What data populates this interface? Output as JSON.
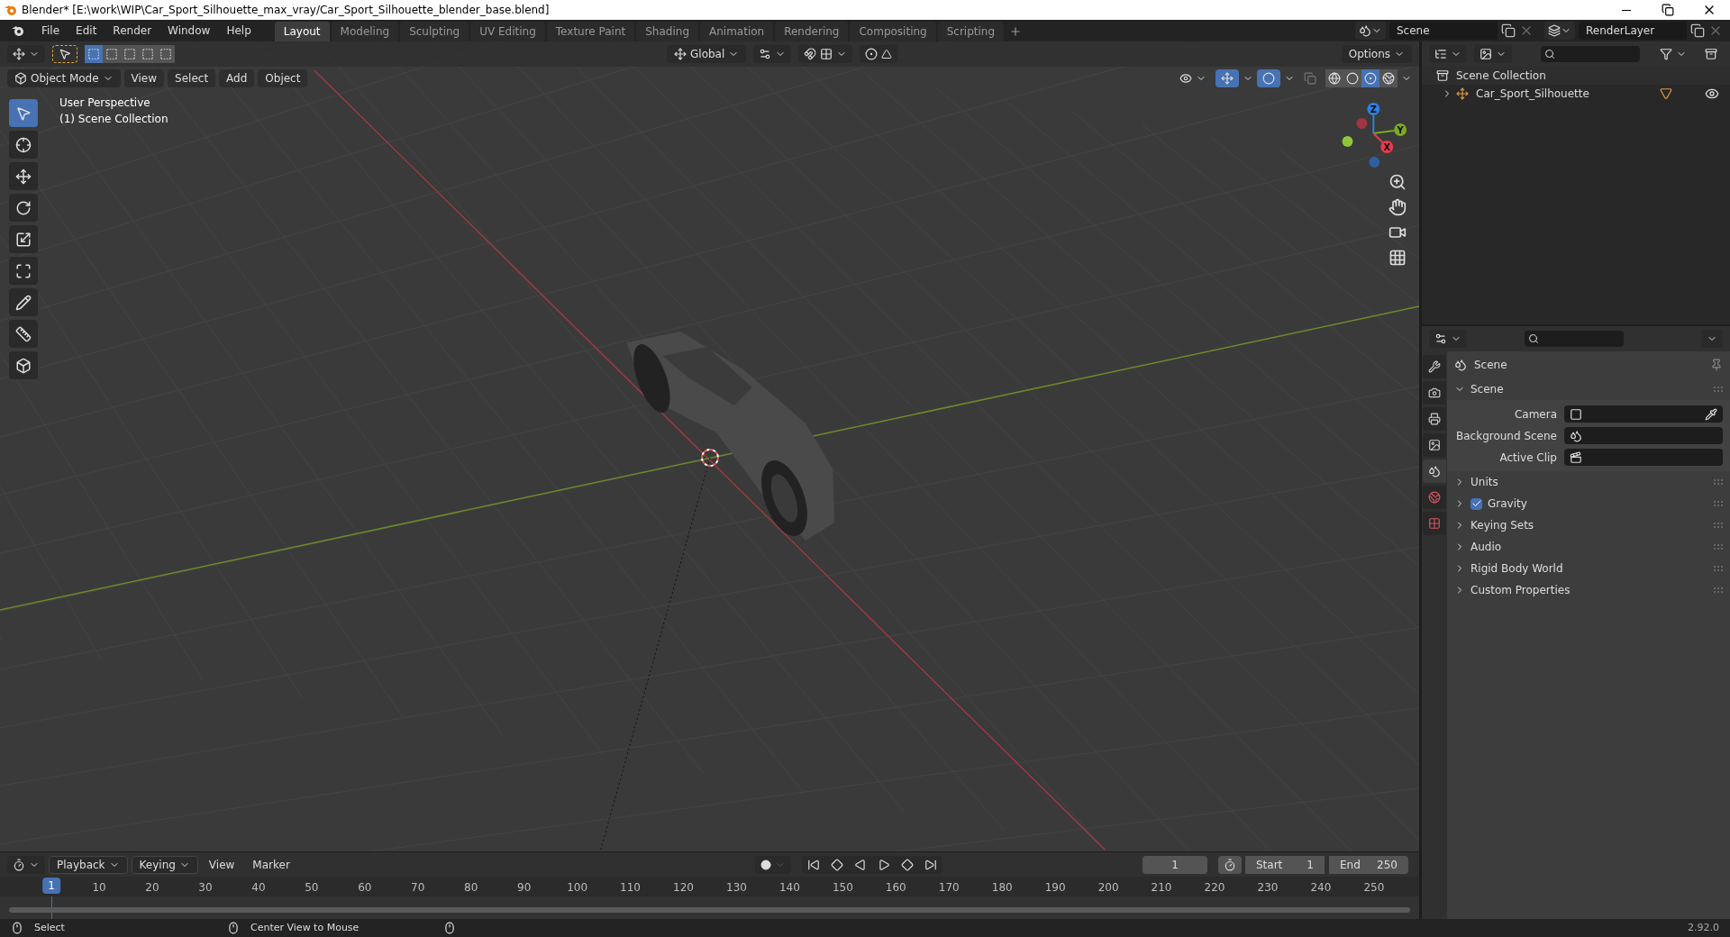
{
  "window": {
    "title": "Blender* [E:\\work\\WIP\\Car_Sport_Silhouette_max_vray/Car_Sport_Silhouette_blender_base.blend]"
  },
  "menu": [
    "File",
    "Edit",
    "Render",
    "Window",
    "Help"
  ],
  "workspaces": [
    {
      "label": "Layout",
      "selected": true
    },
    {
      "label": "Modeling",
      "selected": false
    },
    {
      "label": "Sculpting",
      "selected": false
    },
    {
      "label": "UV Editing",
      "selected": false
    },
    {
      "label": "Texture Paint",
      "selected": false
    },
    {
      "label": "Shading",
      "selected": false
    },
    {
      "label": "Animation",
      "selected": false
    },
    {
      "label": "Rendering",
      "selected": false
    },
    {
      "label": "Compositing",
      "selected": false
    },
    {
      "label": "Scripting",
      "selected": false
    }
  ],
  "scene": "Scene",
  "view_layer": "RenderLayer",
  "tool_header": {
    "transform_orientation": "Global",
    "options": "Options",
    "select_modes": [
      {
        "selected": true
      },
      {
        "selected": false
      },
      {
        "selected": false
      },
      {
        "selected": false
      },
      {
        "selected": false
      }
    ]
  },
  "viewport_header": {
    "mode": "Object Mode",
    "menus": [
      "View",
      "Select",
      "Add",
      "Object"
    ],
    "gizmos_on": true,
    "overlays_on": true,
    "shading": [
      {
        "kind": "wireframe",
        "selected": false
      },
      {
        "kind": "solid",
        "selected": false
      },
      {
        "kind": "material",
        "selected": true
      },
      {
        "kind": "rendered",
        "selected": false
      }
    ]
  },
  "viewport": {
    "overlay_text": [
      "User Perspective",
      "(1) Scene Collection"
    ],
    "tools": [
      {
        "kind": "select",
        "selected": true
      },
      {
        "kind": "cursor",
        "selected": false
      },
      {
        "kind": "move",
        "selected": false
      },
      {
        "kind": "rotate",
        "selected": false
      },
      {
        "kind": "scale",
        "selected": false
      },
      {
        "kind": "transform",
        "selected": false
      },
      {
        "kind": "annotate",
        "selected": false
      },
      {
        "kind": "measure",
        "selected": false
      },
      {
        "kind": "add_cube",
        "selected": false
      }
    ],
    "gizmo_axes": [
      {
        "label": "Z",
        "color": "#2f7fe0"
      },
      {
        "label": "Y",
        "color": "#7aaa1e"
      },
      {
        "label": "X",
        "color": "#e83a4e"
      }
    ]
  },
  "outliner": {
    "root": "Scene Collection",
    "children": [
      {
        "label": "Car_Sport_Silhouette",
        "expanded": false,
        "visible": true
      }
    ]
  },
  "properties": {
    "tabs": [
      {
        "kind": "tool",
        "selected": false
      },
      {
        "kind": "render",
        "selected": false
      },
      {
        "kind": "output",
        "selected": false
      },
      {
        "kind": "view_layer",
        "selected": false
      },
      {
        "kind": "scene",
        "selected": true
      },
      {
        "kind": "world",
        "selected": false
      },
      {
        "kind": "texture",
        "selected": false
      }
    ],
    "context": "Scene",
    "panels": [
      {
        "label": "Scene",
        "expanded": true,
        "fields": [
          {
            "label": "Camera",
            "kind": "object"
          },
          {
            "label": "Background Scene",
            "kind": "scene"
          },
          {
            "label": "Active Clip",
            "kind": "clip"
          }
        ]
      },
      {
        "label": "Units",
        "expanded": false
      },
      {
        "label": "Gravity",
        "expanded": false,
        "checked": true
      },
      {
        "label": "Keying Sets",
        "expanded": false
      },
      {
        "label": "Audio",
        "expanded": false
      },
      {
        "label": "Rigid Body World",
        "expanded": false
      },
      {
        "label": "Custom Properties",
        "expanded": false
      }
    ]
  },
  "timeline": {
    "menus": [
      {
        "label": "Playback",
        "dropdown": true
      },
      {
        "label": "Keying",
        "dropdown": true
      },
      {
        "label": "View",
        "dropdown": false
      },
      {
        "label": "Marker",
        "dropdown": false
      }
    ],
    "current_frame": "1",
    "start_label": "Start",
    "start": "1",
    "end_label": "End",
    "end": "250",
    "playhead": "1",
    "ruler": [
      "10",
      "20",
      "30",
      "40",
      "50",
      "60",
      "70",
      "80",
      "90",
      "100",
      "110",
      "120",
      "130",
      "140",
      "150",
      "160",
      "170",
      "180",
      "190",
      "200",
      "210",
      "220",
      "230",
      "240",
      "250"
    ]
  },
  "status_bar": {
    "hints": [
      "Select",
      "Center View to Mouse"
    ],
    "version": "2.92.0"
  }
}
